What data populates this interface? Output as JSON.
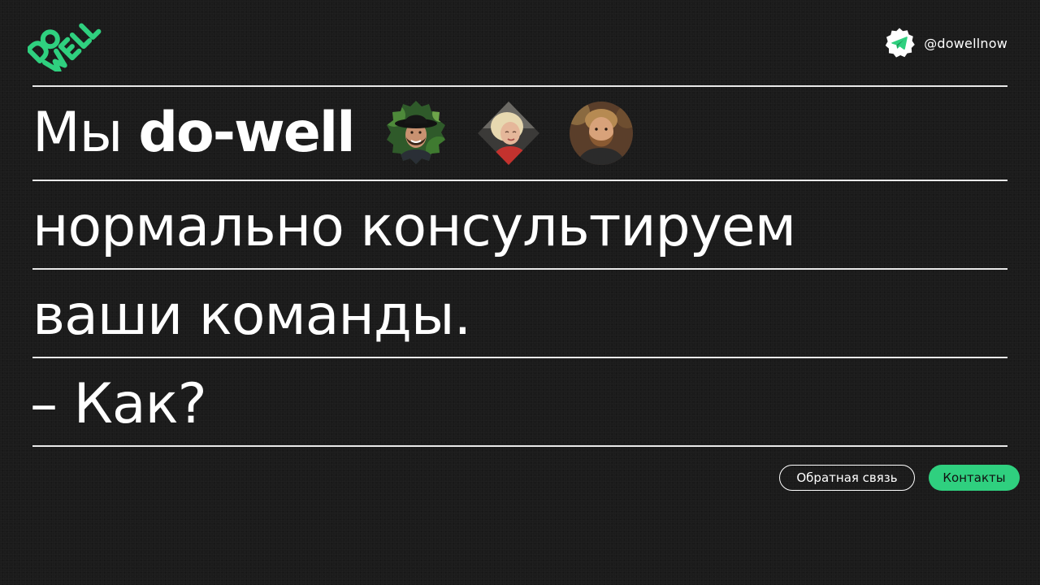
{
  "brand": {
    "logo_alt": "do-well logo",
    "handle": "@dowellnow",
    "accent_color": "#2fd07f",
    "background_color": "#1b1b1b"
  },
  "icons": {
    "logo": "dowell-logo-icon",
    "handle_badge": "telegram-icon"
  },
  "headline": {
    "line1_prefix": "Мы",
    "line1_bold": "do-well",
    "line2": "нормально консультируем",
    "line3": "ваши команды.",
    "line4": "– Как?"
  },
  "team": {
    "avatars": [
      {
        "name": "avatar-man-hat",
        "shape": "flower"
      },
      {
        "name": "avatar-woman-blonde",
        "shape": "diamond"
      },
      {
        "name": "avatar-man-beard",
        "shape": "circle"
      }
    ]
  },
  "actions": {
    "feedback_label": "Обратная связь",
    "contacts_label": "Контакты"
  }
}
